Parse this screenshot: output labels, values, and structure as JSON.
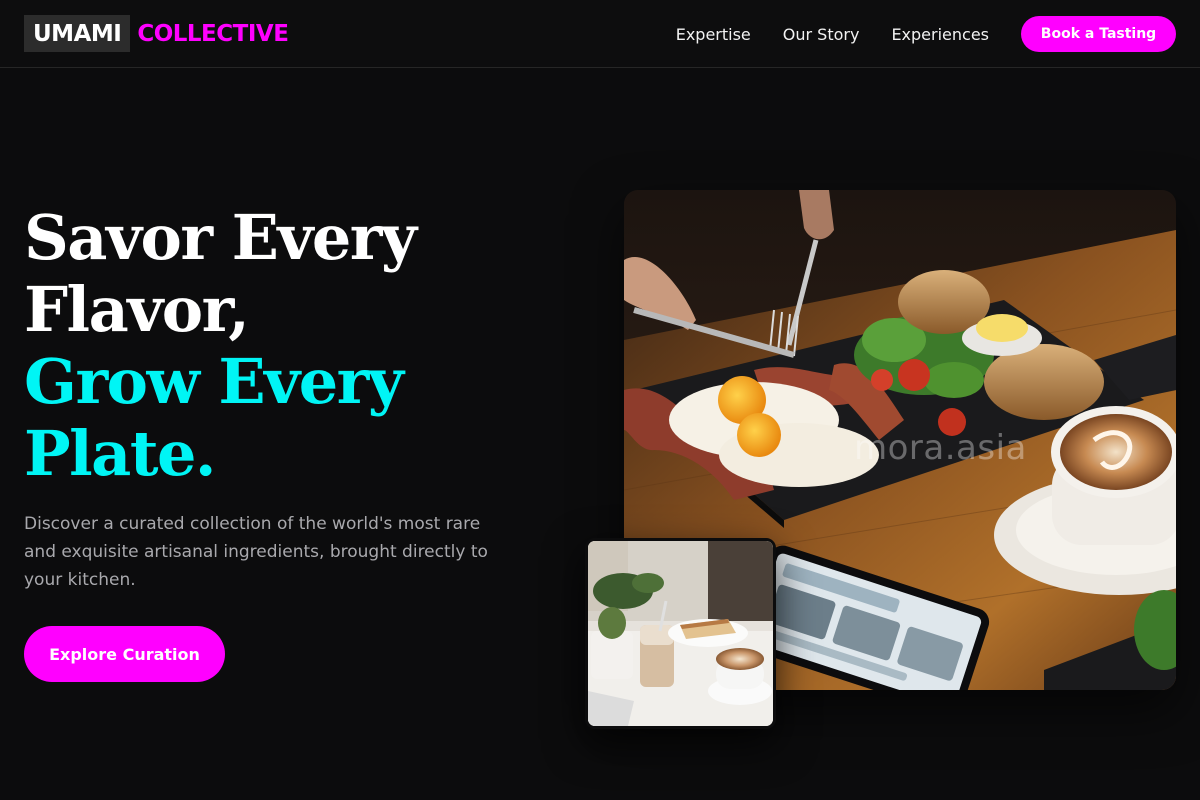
{
  "brand": {
    "primary": "UMAMI",
    "secondary": "COLLECTIVE"
  },
  "nav": {
    "links": [
      "Expertise",
      "Our Story",
      "Experiences"
    ],
    "cta": "Book a Tasting"
  },
  "hero": {
    "line1": "Savor Every",
    "line2": "Flavor,",
    "line3": "Grow Every",
    "line4": "Plate.",
    "subtitle": "Discover a curated collection of the world's most rare and exquisite artisanal ingredients, brought directly to your kitchen.",
    "cta": "Explore Curation"
  },
  "images": {
    "main_photo_watermark": "mora.asia"
  },
  "colors": {
    "background": "#0c0c0d",
    "accent_magenta": "#ff00ff",
    "accent_cyan": "#00f5f5",
    "muted_text": "#a9a9ad"
  }
}
